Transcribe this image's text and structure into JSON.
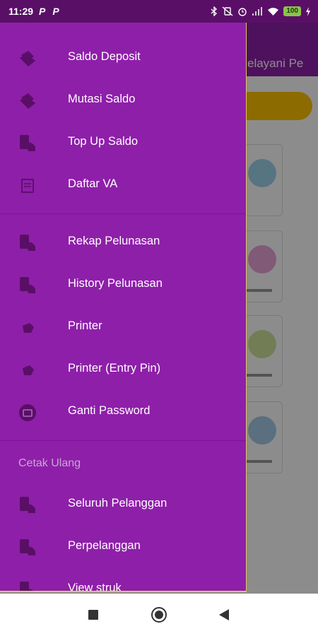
{
  "status_bar": {
    "time": "11:29",
    "notif_icons": [
      "P",
      "P"
    ],
    "battery": "100"
  },
  "background_app": {
    "title_fragment": "elayani Pe",
    "toolbar_color": "#8e1fa9",
    "accent_color": "#ffc400"
  },
  "drawer": {
    "background_color": "#8e1fa9",
    "group1": [
      {
        "label": "Saldo Deposit",
        "icon": "wallet-icon"
      },
      {
        "label": "Mutasi Saldo",
        "icon": "wallet-icon"
      },
      {
        "label": "Top Up Saldo",
        "icon": "document-hand-icon"
      },
      {
        "label": "Daftar VA",
        "icon": "card-list-icon"
      }
    ],
    "group2": [
      {
        "label": "Rekap Pelunasan",
        "icon": "document-hand-icon"
      },
      {
        "label": "History Pelunasan",
        "icon": "document-hand-icon"
      },
      {
        "label": "Printer",
        "icon": "printer-icon"
      },
      {
        "label": "Printer (Entry Pin)",
        "icon": "printer-icon"
      },
      {
        "label": "Ganti Password",
        "icon": "lock-screen-icon"
      }
    ],
    "section_title": "Cetak Ulang",
    "group3": [
      {
        "label": "Seluruh Pelanggan",
        "icon": "document-hand-icon"
      },
      {
        "label": "Perpelanggan",
        "icon": "document-hand-icon"
      },
      {
        "label": "View struk",
        "icon": "document-hand-icon"
      }
    ]
  },
  "nav_bar": {
    "buttons": [
      "recents-button",
      "home-button",
      "back-button"
    ]
  }
}
